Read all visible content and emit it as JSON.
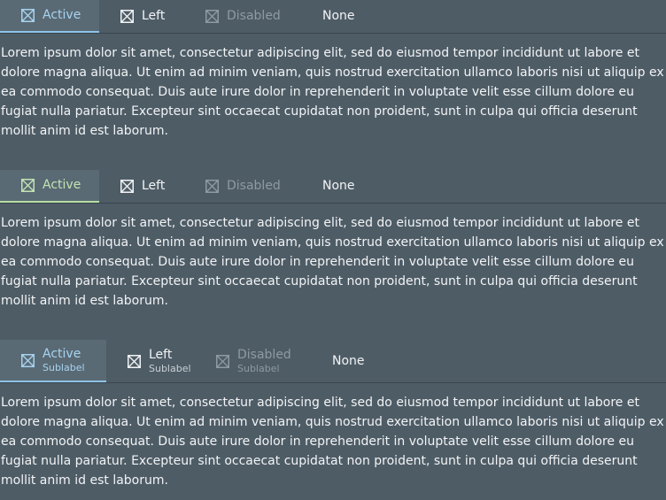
{
  "lorem": "Lorem ipsum dolor sit amet, consectetur adipiscing elit, sed do eiusmod tempor incididunt ut labore et dolore magna aliqua. Ut enim ad minim veniam, quis nostrud exercitation ullamco laboris nisi ut aliquip ex ea commodo consequat. Duis aute irure dolor in reprehenderit in voluptate velit esse cillum dolore eu fugiat nulla pariatur. Excepteur sint occaecat cupidatat non proident, sunt in culpa qui officia deserunt mollit anim id est laborum.",
  "colors": {
    "background": "#4e5c66",
    "active_tab_bg": "#5a6a74",
    "accent_blue": "#8ec3e8",
    "accent_green": "#b6dea6",
    "disabled": "#8f9aa1"
  },
  "sections": [
    {
      "tabs": [
        {
          "label": "Active",
          "icon": "checkbox-x-icon",
          "state": "active"
        },
        {
          "label": "Left",
          "icon": "checkbox-x-icon",
          "state": "normal"
        },
        {
          "label": "Disabled",
          "icon": "checkbox-x-icon",
          "state": "disabled"
        },
        {
          "label": "None",
          "state": "normal"
        }
      ]
    },
    {
      "tabs": [
        {
          "label": "Active",
          "icon": "checkbox-x-icon",
          "state": "active"
        },
        {
          "label": "Left",
          "icon": "checkbox-x-icon",
          "state": "normal"
        },
        {
          "label": "Disabled",
          "icon": "checkbox-x-icon",
          "state": "disabled"
        },
        {
          "label": "None",
          "state": "normal"
        }
      ]
    },
    {
      "tabs": [
        {
          "label": "Active",
          "sublabel": "Sublabel",
          "icon": "checkbox-x-icon",
          "state": "active"
        },
        {
          "label": "Left",
          "sublabel": "Sublabel",
          "icon": "checkbox-x-icon",
          "state": "normal"
        },
        {
          "label": "Disabled",
          "sublabel": "Sublabel",
          "icon": "checkbox-x-icon",
          "state": "disabled"
        },
        {
          "label": "None",
          "state": "normal"
        }
      ]
    }
  ]
}
